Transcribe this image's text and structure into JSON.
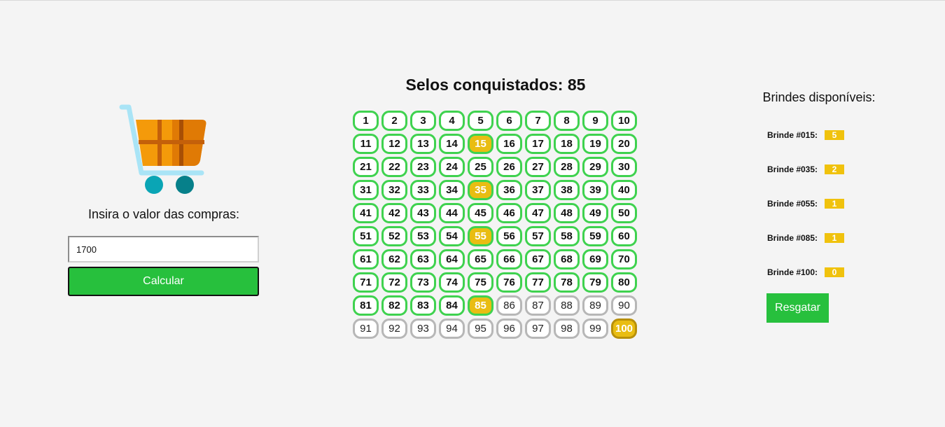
{
  "left": {
    "cart_icon": "shopping-cart-icon",
    "prompt": "Insira o valor das compras:",
    "input_value": "1700",
    "calc_label": "Calcular"
  },
  "center": {
    "title": "Selos conquistados: 85",
    "earned": 85,
    "total": 100,
    "gold_numbers": [
      15,
      35,
      55,
      85,
      100
    ]
  },
  "right": {
    "title": "Brindes disponíveis:",
    "gifts": [
      {
        "label": "Brinde #015:",
        "count": "5"
      },
      {
        "label": "Brinde #035:",
        "count": "2"
      },
      {
        "label": "Brinde #055:",
        "count": "1"
      },
      {
        "label": "Brinde #085:",
        "count": "1"
      },
      {
        "label": "Brinde #100:",
        "count": "0"
      }
    ],
    "redeem_label": "Resgatar"
  },
  "colors": {
    "background": "#f4f4f4",
    "accent_green": "#27c03d",
    "stamp_border_green": "#3fd24f",
    "stamp_gold": "#e9bd12",
    "badge_gold": "#f0c20d"
  }
}
